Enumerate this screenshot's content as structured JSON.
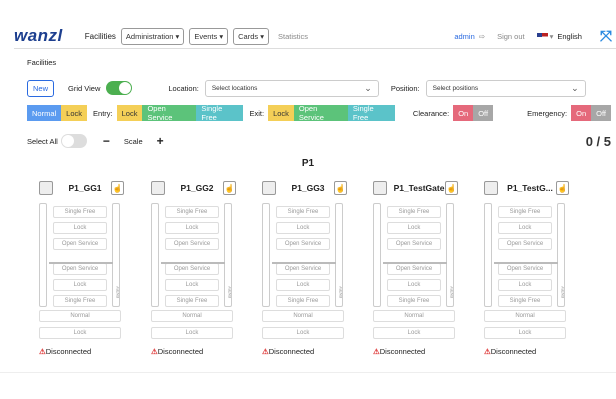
{
  "header": {
    "logo": "wanzl",
    "nav": [
      "Facilities",
      "Administration",
      "Events",
      "Cards",
      "Statistics"
    ],
    "user": "admin",
    "sign_out": "Sign out",
    "language": "English"
  },
  "page": {
    "section": "Facilities",
    "new_button": "New",
    "grid_view_label": "Grid View",
    "location_label": "Location:",
    "location_placeholder": "Select locations",
    "position_label": "Position:",
    "position_placeholder": "Select positions"
  },
  "mode_bar": {
    "normal": "Normal",
    "lock": "Lock",
    "entry_label": "Entry:",
    "entry_lock": "Lock",
    "entry_open": "Open Service",
    "entry_single": "Single Free",
    "exit_label": "Exit:",
    "exit_lock": "Lock",
    "exit_open": "Open Service",
    "exit_single": "Single Free",
    "clearance_label": "Clearance:",
    "clearance_on": "On",
    "clearance_off": "Off",
    "emergency_label": "Emergency:",
    "emergency_on": "On",
    "emergency_off": "Off"
  },
  "controls": {
    "select_all": "Select All",
    "minus": "−",
    "scale": "Scale",
    "plus": "+",
    "count": "0 / 5"
  },
  "group_title": "P1",
  "facilities": [
    {
      "name": "P1_GG1",
      "status": "Disconnected"
    },
    {
      "name": "P1_GG2",
      "status": "Disconnected"
    },
    {
      "name": "P1_GG3",
      "status": "Disconnected"
    },
    {
      "name": "P1_TestGate",
      "status": "Disconnected"
    },
    {
      "name": "P1_TestG...",
      "status": "Disconnected"
    }
  ],
  "cell_labels": {
    "top": [
      "Single Free",
      "Lock",
      "Open Service"
    ],
    "bottom": [
      "Open Service",
      "Lock",
      "Single Free"
    ],
    "footer": [
      "Normal",
      "Lock"
    ],
    "entry_text": "ENTRY"
  },
  "colors": {
    "brand": "#1d3f8f",
    "primary": "#2a6ae0",
    "green": "#5cc37a",
    "red": "#e5697b"
  }
}
